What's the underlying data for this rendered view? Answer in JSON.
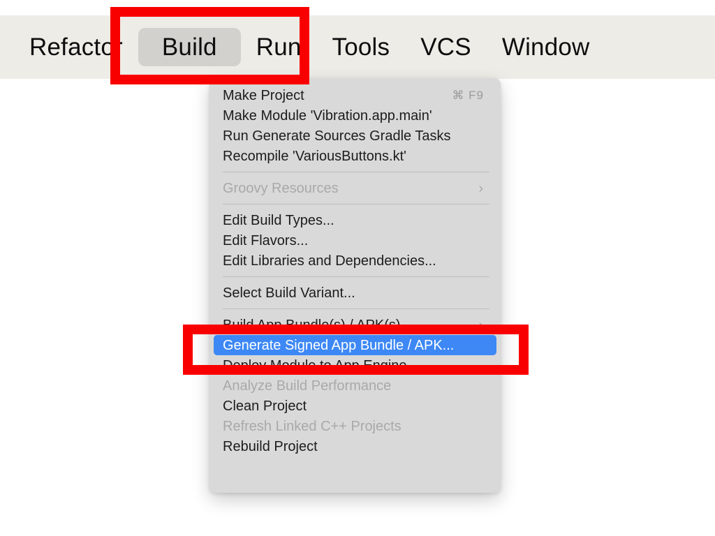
{
  "menubar": {
    "items": [
      {
        "label": "Refactor",
        "active": false
      },
      {
        "label": "Build",
        "active": true
      },
      {
        "label": "Run",
        "active": false
      },
      {
        "label": "Tools",
        "active": false
      },
      {
        "label": "VCS",
        "active": false
      },
      {
        "label": "Window",
        "active": false
      }
    ]
  },
  "build_menu": {
    "title": "Build",
    "rows": [
      {
        "type": "item",
        "label": "Make Project",
        "shortcut": "⌘ F9",
        "enabled": true,
        "selected": false
      },
      {
        "type": "item",
        "label": "Make Module 'Vibration.app.main'",
        "shortcut": "",
        "enabled": true,
        "selected": false
      },
      {
        "type": "item",
        "label": "Run Generate Sources Gradle Tasks",
        "shortcut": "",
        "enabled": true,
        "selected": false
      },
      {
        "type": "item",
        "label": "Recompile 'VariousButtons.kt'",
        "shortcut": "",
        "enabled": true,
        "selected": false
      },
      {
        "type": "separator"
      },
      {
        "type": "item",
        "label": "Groovy Resources",
        "shortcut": "",
        "enabled": false,
        "selected": false,
        "submenu": true
      },
      {
        "type": "separator"
      },
      {
        "type": "item",
        "label": "Edit Build Types...",
        "shortcut": "",
        "enabled": true,
        "selected": false
      },
      {
        "type": "item",
        "label": "Edit Flavors...",
        "shortcut": "",
        "enabled": true,
        "selected": false
      },
      {
        "type": "item",
        "label": "Edit Libraries and Dependencies...",
        "shortcut": "",
        "enabled": true,
        "selected": false
      },
      {
        "type": "separator"
      },
      {
        "type": "item",
        "label": "Select Build Variant...",
        "shortcut": "",
        "enabled": true,
        "selected": false
      },
      {
        "type": "separator"
      },
      {
        "type": "item",
        "label": "Build App Bundle(s) / APK(s)",
        "shortcut": "",
        "enabled": true,
        "selected": false,
        "submenu": true
      },
      {
        "type": "item",
        "label": "Generate Signed App Bundle / APK...",
        "shortcut": "",
        "enabled": true,
        "selected": true
      },
      {
        "type": "item",
        "label": "Deploy Module to App Engine...",
        "shortcut": "",
        "enabled": true,
        "selected": false
      },
      {
        "type": "item",
        "label": "Analyze Build Performance",
        "shortcut": "",
        "enabled": false,
        "selected": false
      },
      {
        "type": "item",
        "label": "Clean Project",
        "shortcut": "",
        "enabled": true,
        "selected": false
      },
      {
        "type": "item",
        "label": "Refresh Linked C++ Projects",
        "shortcut": "",
        "enabled": false,
        "selected": false
      },
      {
        "type": "item",
        "label": "Rebuild Project",
        "shortcut": "",
        "enabled": true,
        "selected": false
      }
    ]
  },
  "annotations": {
    "color": "#f90000",
    "boxes": [
      {
        "name": "build-menu-highlight-box",
        "target": "Build"
      },
      {
        "name": "generate-signed-bundle-highlight-box",
        "target": "Generate Signed App Bundle / APK..."
      }
    ]
  }
}
